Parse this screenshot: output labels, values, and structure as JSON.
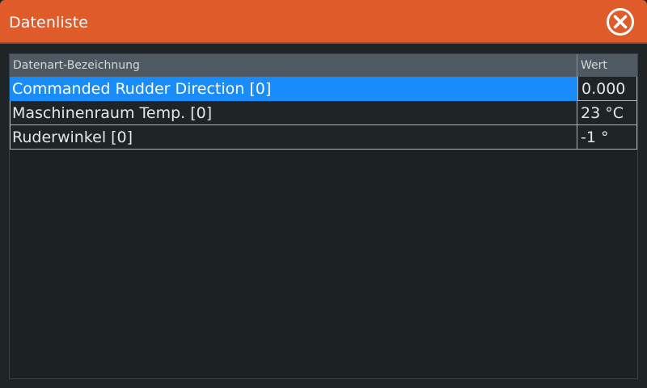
{
  "window": {
    "title": "Datenliste",
    "close_icon": "close-circle-icon",
    "accent_color": "#df5b2a",
    "selection_color": "#1a8cfa"
  },
  "table": {
    "columns": [
      "Datenart-Bezeichnung",
      "Wert"
    ],
    "rows": [
      {
        "name": "Commanded Rudder Direction [0]",
        "value": "0.000",
        "selected": true
      },
      {
        "name": "Maschinenraum Temp. [0]",
        "value": "23 °C",
        "selected": false
      },
      {
        "name": "Ruderwinkel [0]",
        "value": "-1 °",
        "selected": false
      }
    ]
  }
}
